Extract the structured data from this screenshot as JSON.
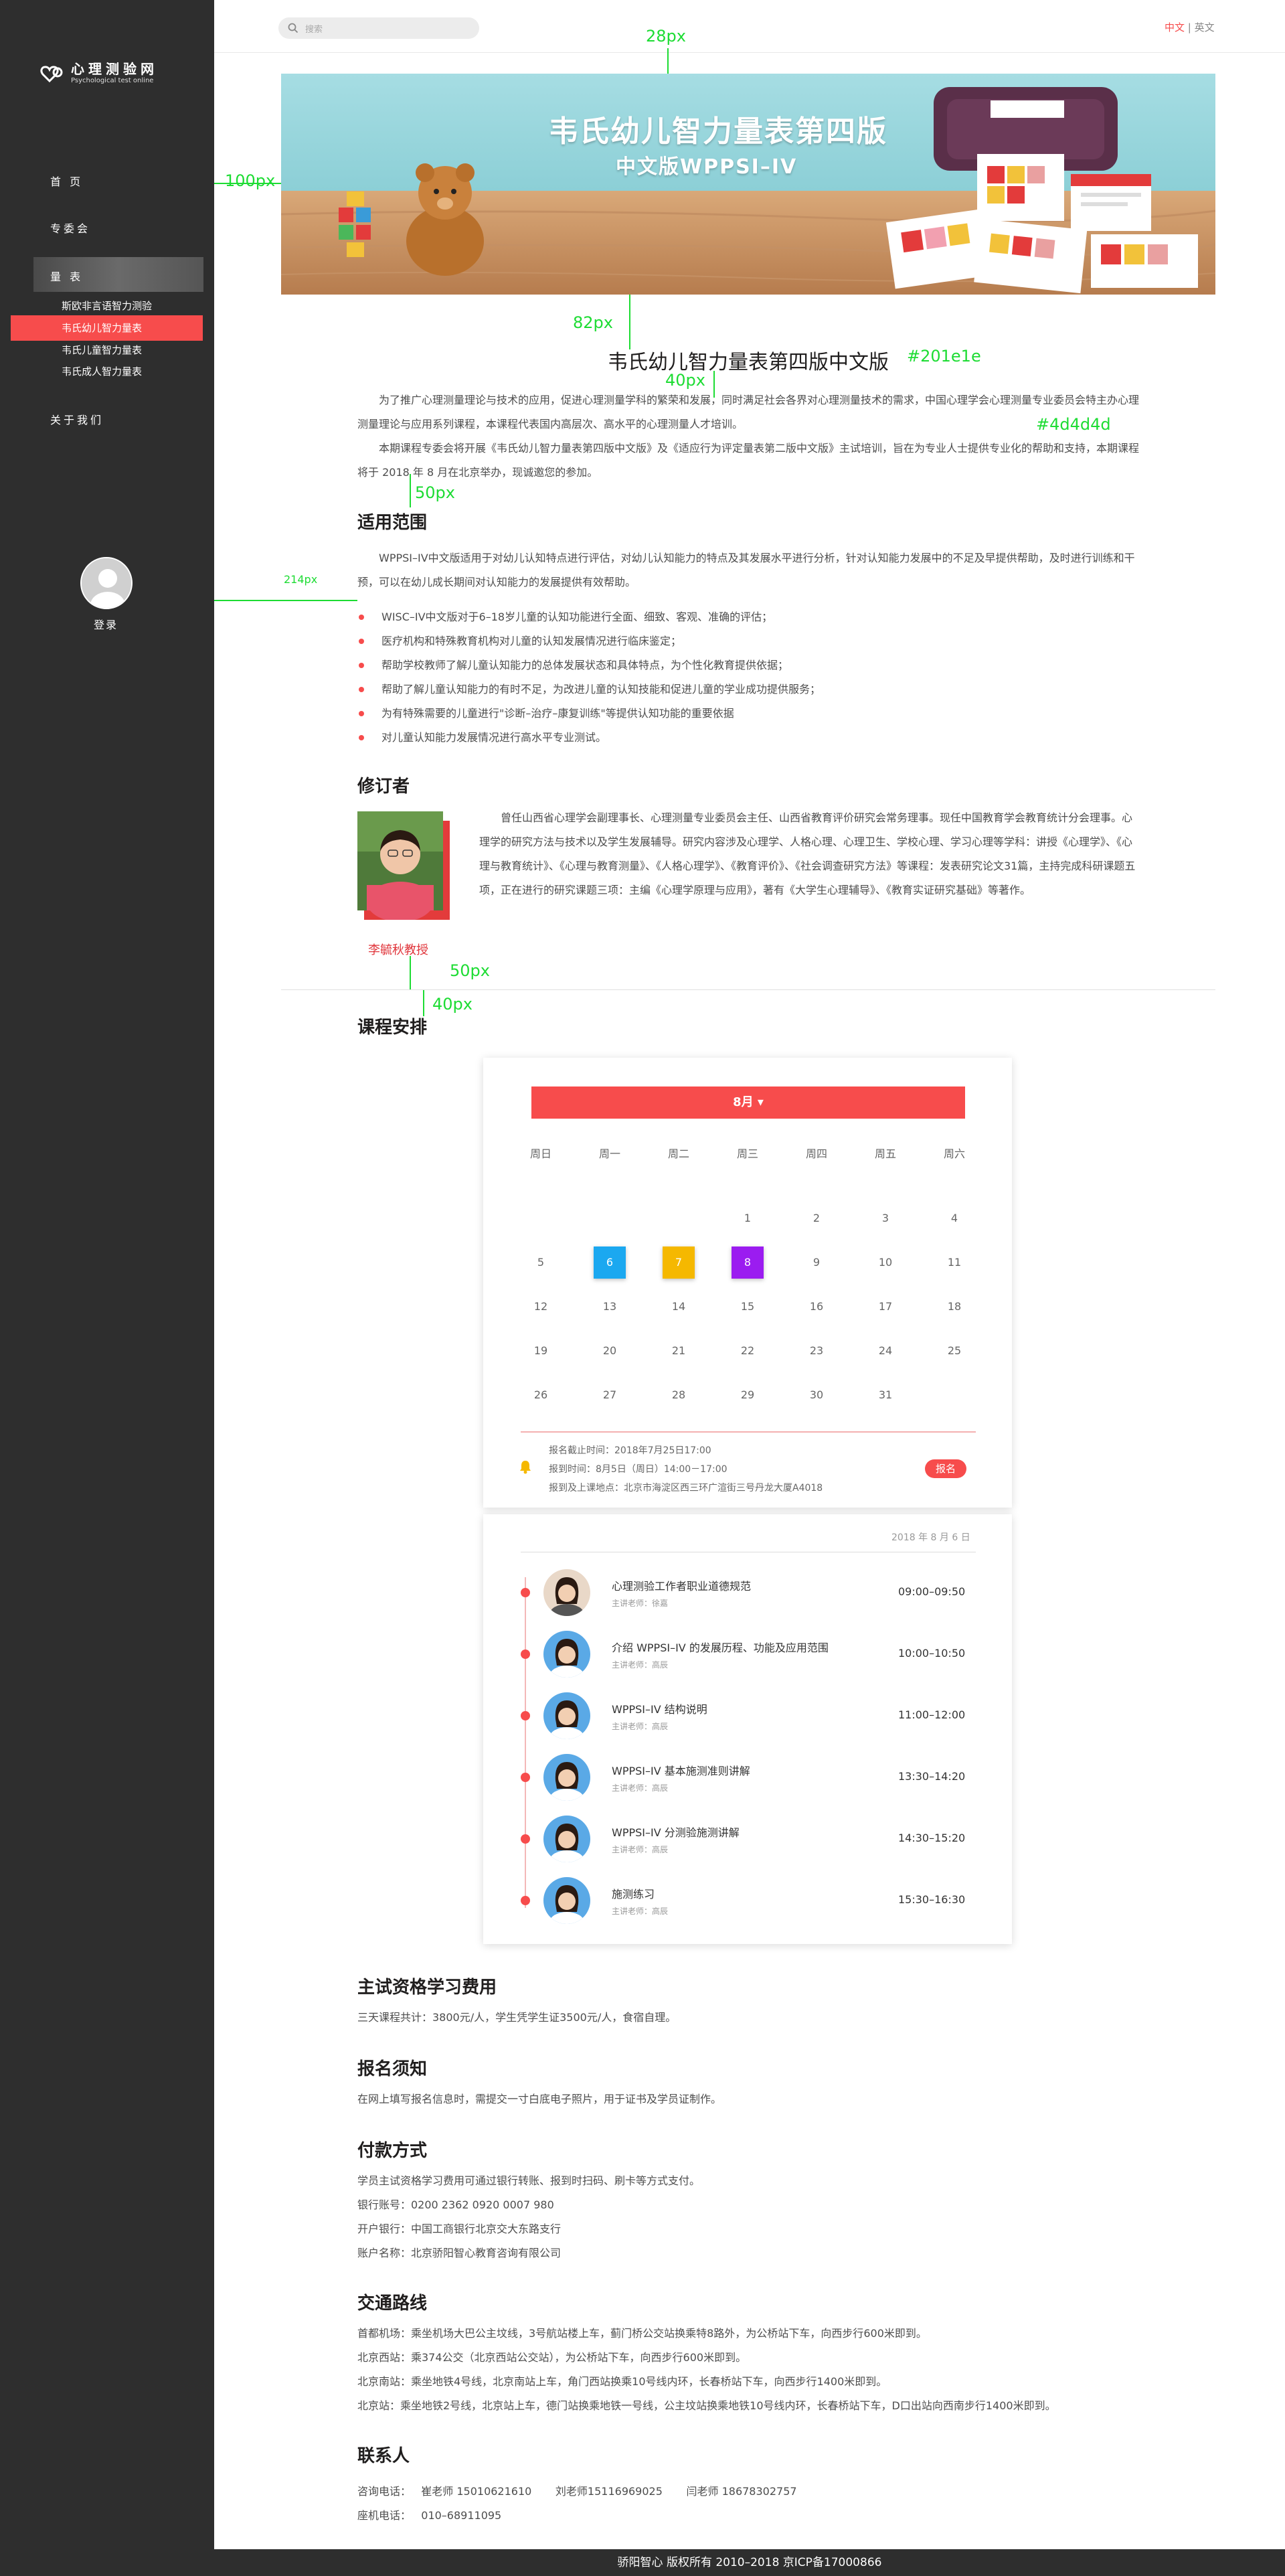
{
  "sidebar": {
    "logo_cn": "心理测验网",
    "logo_en": "Psychological test online",
    "nav": [
      {
        "label": "首 页"
      },
      {
        "label": "专委会"
      },
      {
        "label": "量 表"
      },
      {
        "label": "关于我们"
      }
    ],
    "sub_items": [
      {
        "label": "斯欧非言语智力测验"
      },
      {
        "label": "韦氏幼儿智力量表"
      },
      {
        "label": "韦氏儿童智力量表"
      },
      {
        "label": "韦氏成人智力量表"
      }
    ],
    "login": "登录"
  },
  "header": {
    "search_placeholder": "搜索",
    "lang_cn": "中文",
    "lang_sep": "|",
    "lang_en": "英文"
  },
  "banner": {
    "title": "韦氏幼儿智力量表第四版",
    "subtitle": "中文版WPPSI–IV"
  },
  "annotations": {
    "a28": "28px",
    "a100": "100px",
    "a82": "82px",
    "a40a": "40px",
    "color_title": "#201e1e",
    "color_text": "#4d4d4d",
    "a50a": "50px",
    "a214": "214px",
    "a50b": "50px",
    "a40b": "40px"
  },
  "article": {
    "title": "韦氏幼儿智力量表第四版中文版",
    "intro1": "为了推广心理测量理论与技术的应用，促进心理测量学科的繁荣和发展，同时满足社会各界对心理测量技术的需求，中国心理学会心理测量专业委员会特主办心理测量理论与应用系列课程，本课程代表国内高层次、高水平的心理测量人才培训。",
    "intro2": "本期课程专委会将开展《韦氏幼儿智力量表第四版中文版》及《适应行为评定量表第二版中文版》主试培训，旨在为专业人士提供专业化的帮助和支持，本期课程将于 2018 年 8 月在北京举办，现诚邀您的参加。",
    "scope_heading": "适用范围",
    "scope_text": "WPPSI–IV中文版适用于对幼儿认知特点进行评估，对幼儿认知能力的特点及其发展水平进行分析，针对认知能力发展中的不足及早提供帮助，及时进行训练和干预，可以在幼儿成长期间对认知能力的发展提供有效帮助。",
    "bullets": [
      "WISC–IV中文版对于6–18岁儿童的认知功能进行全面、细致、客观、准确的评估；",
      "医疗机构和特殊教育机构对儿童的认知发展情况进行临床鉴定；",
      "帮助学校教师了解儿童认知能力的总体发展状态和具体特点，为个性化教育提供依据；",
      "帮助了解儿童认知能力的有时不足，为改进儿童的认知技能和促进儿童的学业成功提供服务；",
      "为有特殊需要的儿童进行\"诊断–治疗–康复训练\"等提供认知功能的重要依据",
      "对儿童认知能力发展情况进行高水平专业测试。"
    ],
    "reviser_heading": "修订者",
    "reviser_name": "李毓秋教授",
    "reviser_text": "曾任山西省心理学会副理事长、心理测量专业委员会主任、山西省教育评价研究会常务理事。现任中国教育学会教育统计分会理事。心理学的研究方法与技术以及学生发展辅导。研究内容涉及心理学、人格心理、心理卫生、学校心理、学习心理等学科：讲授《心理学》、《心理与教育统计》、《心理与教育测量》、《人格心理学》、《教育评价》、《社会调查研究方法》等课程：发表研究论文31篇，主持完成科研课题五项，正在进行的研究课题三项：主编《心理学原理与应用》，著有《大学生心理辅导》、《教育实证研究基础》等著作。",
    "schedule_heading": "课程安排"
  },
  "calendar": {
    "month": "8月 ▾",
    "weekdays": [
      "周日",
      "周一",
      "周二",
      "周三",
      "周四",
      "周五",
      "周六"
    ],
    "days": [
      "1",
      "2",
      "3",
      "4",
      "5",
      "6",
      "7",
      "8",
      "9",
      "10",
      "11",
      "12",
      "13",
      "14",
      "15",
      "16",
      "17",
      "18",
      "19",
      "20",
      "21",
      "22",
      "23",
      "24",
      "25",
      "26",
      "27",
      "28",
      "29",
      "30",
      "31"
    ],
    "highlight_colors": {
      "6": "#1ba8f0",
      "7": "#f5b800",
      "8": "#9b1cf0"
    },
    "info1": "报名截止时间：2018年7月25日17:00",
    "info2": "报到时间：8月5日（周日）14:00－17:00",
    "info3": "报到及上课地点：北京市海淀区西三环广渲街三号丹龙大厦A4018",
    "signup": "报名"
  },
  "schedule": {
    "date": "2018 年 8 月 6 日",
    "items": [
      {
        "title": "心理测验工作者职业道德规范",
        "teacher": "主讲老师：徐嘉",
        "time": "09:00–09:50"
      },
      {
        "title": "介绍 WPPSI–IV 的发展历程、功能及应用范围",
        "teacher": "主讲老师：高辰",
        "time": "10:00–10:50"
      },
      {
        "title": "WPPSI–IV 结构说明",
        "teacher": "主讲老师：高辰",
        "time": "11:00–12:00"
      },
      {
        "title": "WPPSI–IV 基本施测准则讲解",
        "teacher": "主讲老师：高辰",
        "time": "13:30–14:20"
      },
      {
        "title": "WPPSI–IV 分测验施测讲解",
        "teacher": "主讲老师：高辰",
        "time": "14:30–15:20"
      },
      {
        "title": "施测练习",
        "teacher": "主讲老师：高辰",
        "time": "15:30–16:30"
      }
    ]
  },
  "fees": {
    "heading": "主试资格学习费用",
    "text": "三天课程共计：3800元/人，学生凭学生证3500元/人，食宿自理。"
  },
  "notice": {
    "heading": "报名须知",
    "text": "在网上填写报名信息时，需提交一寸白底电子照片，用于证书及学员证制作。"
  },
  "payment": {
    "heading": "付款方式",
    "lines": [
      "学员主试资格学习费用可通过银行转账、报到时扫码、刷卡等方式支付。",
      "银行账号：0200 2362 0920 0007 980",
      "开户银行：中国工商银行北京交大东路支行",
      "账户名称：北京骄阳智心教育咨询有限公司"
    ]
  },
  "traffic": {
    "heading": "交通路线",
    "lines": [
      "首都机场：乘坐机场大巴公主坟线，3号航站楼上车，蓟门桥公交站换乘特8路外，为公桥站下车，向西步行600米即到。",
      "北京西站：乘374公交（北京西站公交站），为公桥站下车，向西步行600米即到。",
      "北京南站：乘坐地铁4号线，北京南站上车，角门西站换乘10号线内环，长春桥站下车，向西步行1400米即到。",
      "北京站：乘坐地铁2号线，北京站上车，德门站换乘地铁一号线，公主坟站换乘地铁10号线内环，长春桥站下车，D口出站向西南步行1400米即到。"
    ]
  },
  "contact": {
    "heading": "联系人",
    "lines": [
      "咨询电话：   崔老师 15010621610       刘老师15116969025       闫老师 18678302757",
      "座机电话：   010–68911095"
    ]
  },
  "footer": {
    "text": "骄阳智心 版权所有 2010–2018 京ICP备17000866"
  }
}
